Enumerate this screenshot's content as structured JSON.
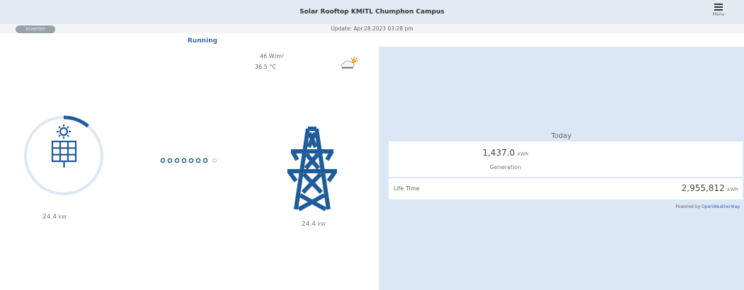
{
  "header": {
    "title": "Solar Rooftop KMITL Chumphon Campus",
    "menu_label": "Menu",
    "menu_icon": "hamburger-menu-icon"
  },
  "subbar": {
    "inverter_label": "Inverter",
    "update_text": "Update: Apr.28.2023 03:28 pm"
  },
  "status": {
    "text": "Running"
  },
  "weather": {
    "irradiance": "46 W/m²",
    "temperature": "36.5 °C",
    "icon": "cloud-sun-icon"
  },
  "solar": {
    "power_value": "24.4",
    "power_unit": "kW",
    "progress_fraction": 0.11,
    "icon": "solar-panel-icon",
    "color": "#1f5c99"
  },
  "grid": {
    "power_value": "24.4",
    "power_unit": "kW",
    "icon": "transmission-tower-icon"
  },
  "today": {
    "label": "Today",
    "generation_value": "1,437.0",
    "generation_unit": "kWh",
    "generation_label": "Generation",
    "lifetime_label": "Life Time",
    "lifetime_value": "2,955,812",
    "lifetime_unit": "kWh"
  },
  "footer": {
    "powered_prefix": "Powered by",
    "powered_link": "OpenWeatherMap"
  },
  "colors": {
    "accent": "#1f5c99",
    "panel_bg": "#dbe7f5",
    "header_bg": "#e3eaf2"
  }
}
